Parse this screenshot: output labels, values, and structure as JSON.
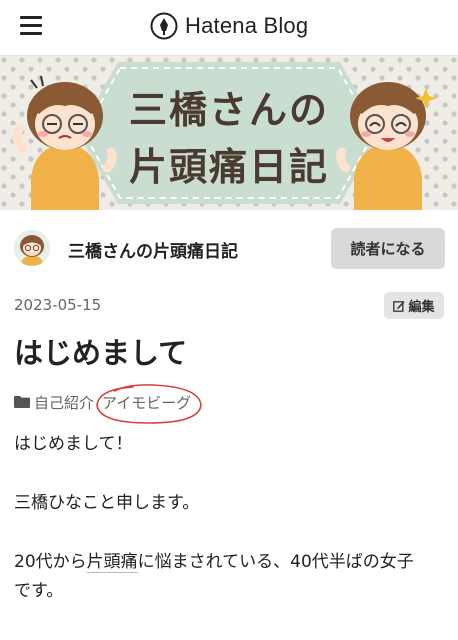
{
  "header": {
    "menu_icon": "hamburger-icon",
    "brand_icon": "hatena-pen-icon",
    "brand_text": "Hatena Blog"
  },
  "banner": {
    "title_line1": "三橋さんの",
    "title_line2": "片頭痛日記",
    "colors": {
      "background": "#f0ede6",
      "dots": "#c8c8c8",
      "hexagon": "#c9ddd0",
      "title": "#4a3a30"
    }
  },
  "blog": {
    "name": "三橋さんの片頭痛日記",
    "subscribe_label": "読者になる"
  },
  "entry": {
    "date": "2023-05-15",
    "edit_label": "編集",
    "title": "はじめまして",
    "categories": [
      "自己紹介",
      "アイモビーグ"
    ],
    "body": {
      "p1": "はじめまして！",
      "p2": "三橋ひなこと申します。",
      "p3_pre": "20代から",
      "p3_keyword": "片頭痛",
      "p3_post": "に悩まされている、40代半ばの女子",
      "p3_line2": "です。"
    }
  },
  "annotation_color": "#d9413d"
}
